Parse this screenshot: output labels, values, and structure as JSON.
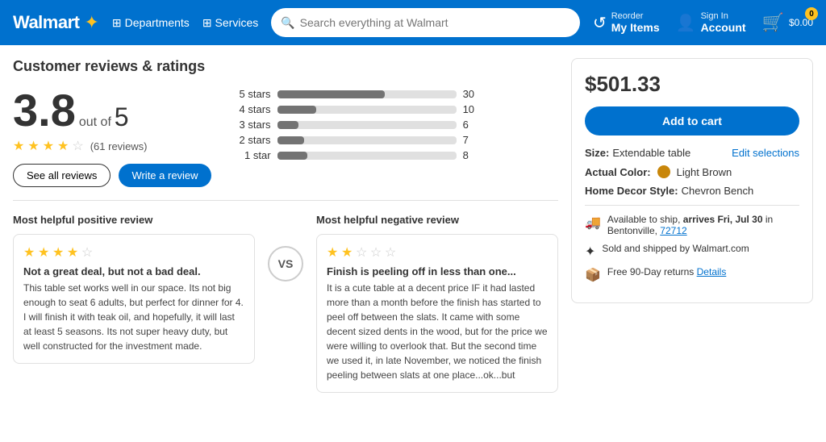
{
  "nav": {
    "logo_text": "Walmart",
    "spark": "✦",
    "departments_label": "Departments",
    "services_label": "Services",
    "search_placeholder": "Search everything at Walmart",
    "reorder_label": "Reorder",
    "reorder_sub": "My Items",
    "signin_label": "Sign In",
    "signin_sub": "Account",
    "cart_badge": "0",
    "cart_price": "$0.00"
  },
  "reviews": {
    "section_title": "Customer reviews & ratings",
    "big_number": "3.8",
    "out_of": "out of",
    "out_of_5": "5",
    "total_reviews": "61 reviews",
    "bars": [
      {
        "label": "5 stars",
        "count": 30,
        "pct": 60
      },
      {
        "label": "4 stars",
        "count": 10,
        "pct": 22
      },
      {
        "label": "3 stars",
        "count": 6,
        "pct": 12
      },
      {
        "label": "2 stars",
        "count": 7,
        "pct": 15
      },
      {
        "label": "1 star",
        "count": 8,
        "pct": 17
      }
    ],
    "see_all_label": "See all reviews",
    "write_label": "Write a review",
    "positive_title": "Most helpful positive review",
    "negative_title": "Most helpful negative review",
    "vs_label": "VS",
    "positive_review": {
      "stars": 4,
      "headline": "Not a great deal, but not a bad deal.",
      "body": "This table set works well in our space. Its not big enough to seat 6 adults, but perfect for dinner for 4. I will finish it with teak oil, and hopefully, it will last at least 5 seasons. Its not super heavy duty, but well constructed for the investment made."
    },
    "negative_review": {
      "stars": 2,
      "headline": "Finish is peeling off in less than one...",
      "body": "It is a cute table at a decent price IF it had lasted more than a month before the finish has started to peel off between the slats. It came with some decent sized dents in the wood, but for the price we were willing to overlook that. But the second time we used it, in late November, we noticed the finish peeling between slats at one place...ok...but"
    }
  },
  "product": {
    "price": "$501.33",
    "add_cart_label": "Add to cart",
    "size_label": "Size:",
    "size_value": "Extendable table",
    "edit_label": "Edit selections",
    "color_label": "Actual Color:",
    "color_name": "Light Brown",
    "style_label": "Home Decor Style:",
    "style_value": "Chevron Bench",
    "shipping_text": "Available to ship, arrives Fri, Jul 30 in Bentonville, 72712",
    "sold_by": "Sold and shipped by Walmart.com",
    "returns": "Free 90-Day returns",
    "details_link": "Details"
  }
}
